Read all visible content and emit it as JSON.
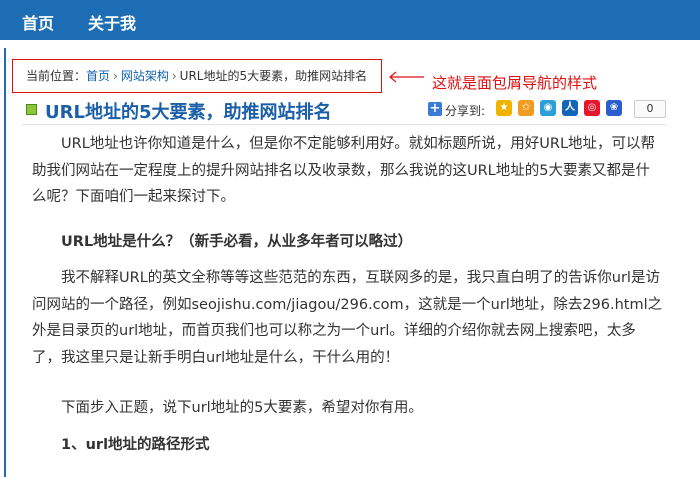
{
  "nav": {
    "home": "首页",
    "about": "关于我"
  },
  "breadcrumb": {
    "prefix": "当前位置：",
    "home": "首页",
    "separator": "›",
    "category": "网站架构",
    "current": "URL地址的5大要素，助推网站排名"
  },
  "annotation": {
    "text": "这就是面包屑导航的样式",
    "color": "#e01010"
  },
  "article": {
    "title": "URL地址的5大要素，助推网站排名",
    "share_label": "分享到:",
    "share_count": "0",
    "paragraphs": {
      "p1": "URL地址也许你知道是什么，但是你不定能够利用好。就如标题所说，用好URL地址，可以帮助我们网站在一定程度上的提升网站排名以及收录数，那么我说的这URL地址的5大要素又都是什么呢？下面咱们一起来探讨下。",
      "h1": "URL地址是什么？（新手必看，从业多年者可以略过）",
      "p2": "我不解释URL的英文全称等等这些范范的东西，互联网多的是，我只直白明了的告诉你url是访问网站的一个路径，例如seojishu.com/jiagou/296.com，这就是一个url地址，除去296.html之外是目录页的url地址，而首页我们也可以称之为一个url。详细的介绍你就去网上搜索吧，太多了，我这里只是让新手明白url地址是什么，干什么用的！",
      "p3": "下面步入正题，说下url地址的5大要素，希望对你有用。",
      "h2": "1、url地址的路径形式"
    }
  },
  "colors": {
    "nav_bg": "#1c6db4",
    "title": "#1a5fa8",
    "link": "#1060b0"
  },
  "icons": {
    "title_bullet": "green-square-icon",
    "share": [
      "qzone-icon",
      "star-icon",
      "tencent-weibo-icon",
      "renren-icon",
      "sina-weibo-icon",
      "baidu-icon"
    ]
  }
}
